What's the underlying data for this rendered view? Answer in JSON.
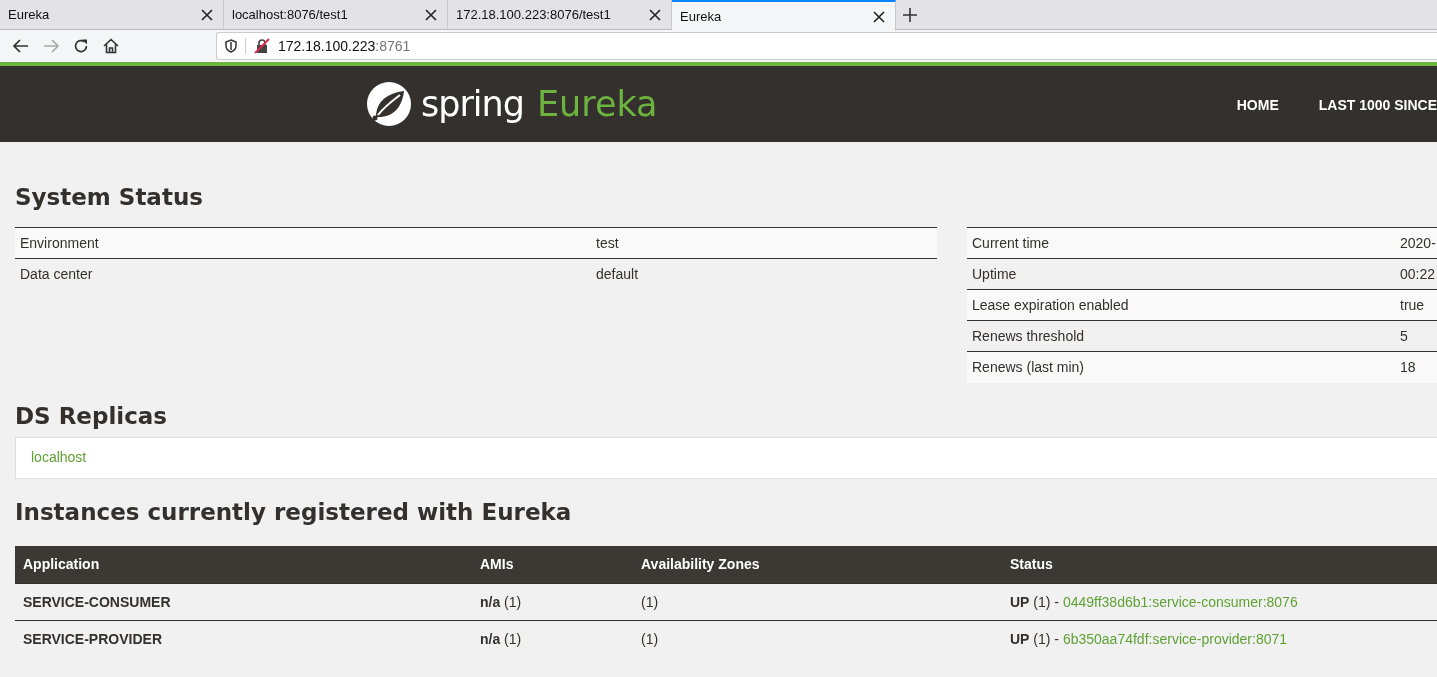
{
  "browser": {
    "tabs": [
      {
        "title": "Eureka",
        "selected": false
      },
      {
        "title": "localhost:8076/test1",
        "selected": false
      },
      {
        "title": "172.18.100.223:8076/test1",
        "selected": false
      },
      {
        "title": "Eureka",
        "selected": true
      }
    ],
    "forward_disabled": true,
    "address": {
      "host": "172.18.100.223",
      "port": ":8761"
    }
  },
  "header": {
    "logo": {
      "word1": "spring",
      "word2": "Eureka"
    },
    "nav": [
      "HOME",
      "LAST 1000 SINCE"
    ]
  },
  "system_status": {
    "title": "System Status",
    "tables": [
      {
        "rows": [
          {
            "label": "Environment",
            "value": "test"
          },
          {
            "label": "Data center",
            "value": "default"
          }
        ]
      },
      {
        "rows": [
          {
            "label": "Current time",
            "value": "2020-"
          },
          {
            "label": "Uptime",
            "value": "00:22"
          },
          {
            "label": "Lease expiration enabled",
            "value": "true"
          },
          {
            "label": "Renews threshold",
            "value": "5"
          },
          {
            "label": "Renews (last min)",
            "value": "18"
          }
        ]
      }
    ]
  },
  "ds_replicas": {
    "title": "DS Replicas",
    "items": [
      "localhost"
    ]
  },
  "instances": {
    "title": "Instances currently registered with Eureka",
    "columns": [
      "Application",
      "AMIs",
      "Availability Zones",
      "Status"
    ],
    "rows": [
      {
        "application": "SERVICE-CONSUMER",
        "amis": "**n/a** (1)",
        "zones": "(1)",
        "status": "**UP** (1) - ",
        "instance": "0449ff38d6b1:service-consumer:8076"
      },
      {
        "application": "SERVICE-PROVIDER",
        "amis": "**n/a** (1)",
        "zones": "(1)",
        "status": "**UP** (1) - ",
        "instance": "6b350aa74fdf:service-provider:8071"
      }
    ]
  }
}
